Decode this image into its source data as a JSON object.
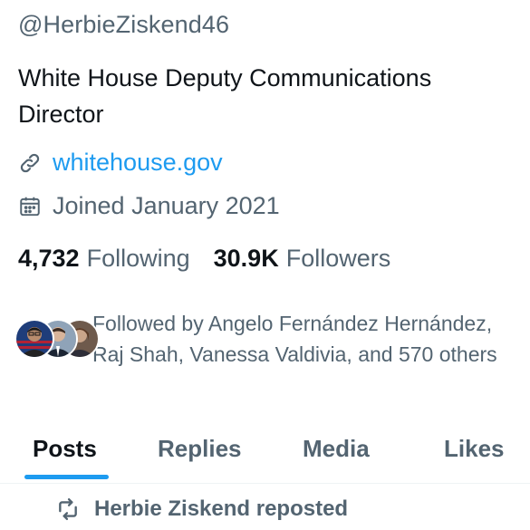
{
  "profile": {
    "handle": "@HerbieZiskend46",
    "bio": "White House Deputy Communications Director",
    "website": {
      "icon": "link-icon",
      "text": "whitehouse.gov"
    },
    "joined": {
      "icon": "calendar-icon",
      "text": "Joined January 2021"
    },
    "stats": {
      "following_count": "4,732",
      "following_label": "Following",
      "followers_count": "30.9K",
      "followers_label": "Followers"
    },
    "followed_by": "Followed by Angelo Fernández Hernández, Raj Shah, Vanessa Valdivia, and 570 others"
  },
  "tabs": [
    {
      "label": "Posts",
      "active": true
    },
    {
      "label": "Replies",
      "active": false
    },
    {
      "label": "Media",
      "active": false
    },
    {
      "label": "Likes",
      "active": false
    }
  ],
  "feed": {
    "repost_banner": {
      "icon": "repost-icon",
      "text": "Herbie Ziskend reposted"
    }
  },
  "colors": {
    "accent": "#1d9bf0",
    "primary_text": "#0f1419",
    "secondary_text": "#536471"
  }
}
